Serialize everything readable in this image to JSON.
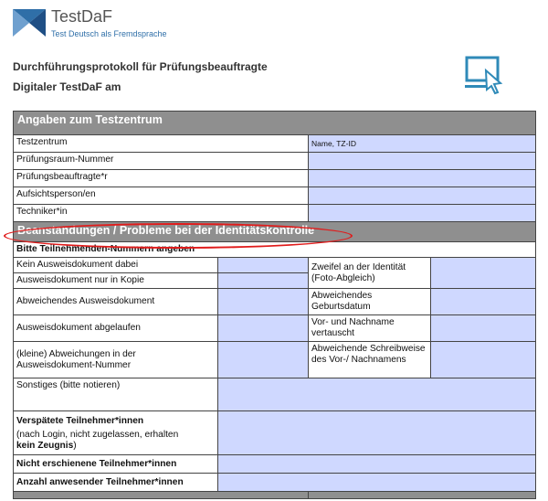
{
  "logo": {
    "name": "TestDaF",
    "tagline": "Test Deutsch als Fremdsprache"
  },
  "document": {
    "title_line1": "Durchführungsprotokoll für Prüfungsbeauftragte",
    "title_line2": "Digitaler TestDaF am"
  },
  "section1": {
    "heading": "Angaben zum Testzentrum",
    "rows": [
      {
        "label": "Testzentrum",
        "value": "Name, TZ-ID"
      },
      {
        "label": "Prüfungsraum-Nummer",
        "value": ""
      },
      {
        "label": "Prüfungsbeauftragte*r",
        "value": ""
      },
      {
        "label": "Aufsichtsperson/en",
        "value": ""
      },
      {
        "label": "Techniker*in",
        "value": ""
      }
    ]
  },
  "section2": {
    "heading": "Beanstandungen / Probleme bei der Identitätskontrolle",
    "subheading": "Bitte Teilnehmenden-Nummern angeben",
    "left_items": [
      "Kein Ausweisdokument dabei",
      "Ausweisdokument nur in Kopie",
      "Abweichendes Ausweisdokument",
      "Ausweisdokument abgelaufen",
      "(kleine) Abweichungen in der Ausweisdokument-Nummer"
    ],
    "right_items": [
      "Zweifel an der Identität (Foto-Abgleich)",
      "Abweichendes Geburtsdatum",
      "Vor- und Nachname vertauscht",
      "Abweichende Schreibweise des Vor-/ Nachnamens"
    ],
    "other_label": "Sonstiges (bitte notieren)",
    "late": {
      "title": "Verspätete Teilnehmer*innen",
      "note": "(nach Login, nicht zugelassen, erhalten",
      "note_bold": "kein Zeugnis",
      "note_end": ")"
    },
    "absent_label": "Nicht erschienene Teilnehmer*innen",
    "present_label": "Anzahl anwesender Teilnehmer*innen"
  },
  "colors": {
    "header_gray": "#8f8f8f",
    "field_blue": "#cfd8ff",
    "highlight_red": "#e01b1b",
    "brand_blue": "#2f6fa8"
  }
}
